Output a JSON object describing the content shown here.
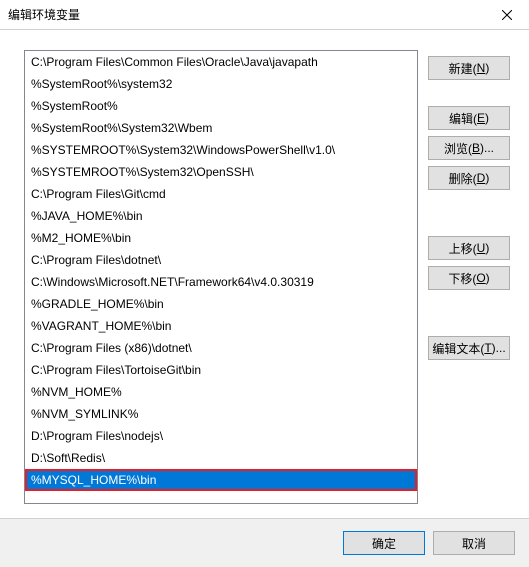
{
  "title": "编辑环境变量",
  "list_items": [
    "C:\\Program Files\\Common Files\\Oracle\\Java\\javapath",
    "%SystemRoot%\\system32",
    "%SystemRoot%",
    "%SystemRoot%\\System32\\Wbem",
    "%SYSTEMROOT%\\System32\\WindowsPowerShell\\v1.0\\",
    "%SYSTEMROOT%\\System32\\OpenSSH\\",
    "C:\\Program Files\\Git\\cmd",
    "%JAVA_HOME%\\bin",
    "%M2_HOME%\\bin",
    "C:\\Program Files\\dotnet\\",
    "C:\\Windows\\Microsoft.NET\\Framework64\\v4.0.30319",
    "%GRADLE_HOME%\\bin",
    "%VAGRANT_HOME%\\bin",
    "C:\\Program Files (x86)\\dotnet\\",
    "C:\\Program Files\\TortoiseGit\\bin",
    "%NVM_HOME%",
    "%NVM_SYMLINK%",
    "D:\\Program Files\\nodejs\\",
    "D:\\Soft\\Redis\\",
    "%MYSQL_HOME%\\bin"
  ],
  "selected_index": 19,
  "buttons": {
    "new": {
      "text": "新建(",
      "key": "N",
      "suffix": ")"
    },
    "edit": {
      "text": "编辑(",
      "key": "E",
      "suffix": ")"
    },
    "browse": {
      "text": "浏览(",
      "key": "B",
      "suffix": ")..."
    },
    "delete": {
      "text": "删除(",
      "key": "D",
      "suffix": ")"
    },
    "up": {
      "text": "上移(",
      "key": "U",
      "suffix": ")"
    },
    "down": {
      "text": "下移(",
      "key": "O",
      "suffix": ")"
    },
    "edit_text": {
      "text": "编辑文本(",
      "key": "T",
      "suffix": ")..."
    }
  },
  "footer": {
    "ok": "确定",
    "cancel": "取消"
  }
}
